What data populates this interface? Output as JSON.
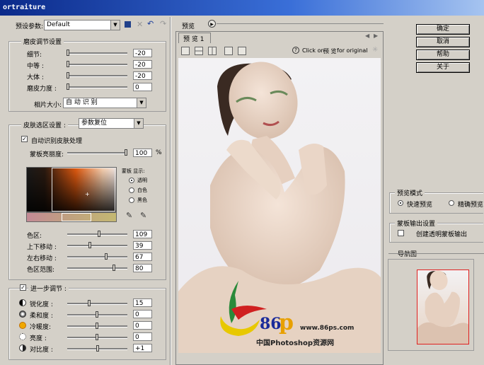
{
  "window": {
    "title": "ortraiture"
  },
  "preset": {
    "label": "预设参数:",
    "value": "Default"
  },
  "smoothing": {
    "title": "磨皮调节设置",
    "sliders": [
      {
        "label": "细节:",
        "value": "-20",
        "level": 0.0
      },
      {
        "label": "中等 :",
        "value": "-20",
        "level": 0.0
      },
      {
        "label": "大体 :",
        "value": "-20",
        "level": 0.0
      },
      {
        "label": "磨皮力度 :",
        "value": "0",
        "level": 0.0
      }
    ],
    "photo_size_label": "相片大小:",
    "photo_size_value": "自 动 识 别"
  },
  "skin": {
    "title_label": "皮肤选区设置 :",
    "title_value": "参数复位",
    "auto_detect_label": "自动识别皮肤处理",
    "mask_brightness_label": "蒙板亮丽度:",
    "mask_brightness_value": "100",
    "mask_brightness_unit": "%",
    "mask_display_label": "蒙板 显示:",
    "mask_options": [
      "透明",
      "白色",
      "黑色"
    ],
    "sliders": [
      {
        "label": "色区:",
        "value": "109",
        "level": 0.43
      },
      {
        "label": "上下移动 :",
        "value": "39",
        "level": 0.39
      },
      {
        "label": "左右移动 :",
        "value": "67",
        "level": 0.67
      },
      {
        "label": "色区范围:",
        "value": "80",
        "level": 0.8
      }
    ]
  },
  "further": {
    "title": "进一步调节 :",
    "sliders": [
      {
        "label": "锐化度 :",
        "value": "15",
        "level": 0.35,
        "icon": "sharpen-icon"
      },
      {
        "label": "柔和度 :",
        "value": "0",
        "level": 0.5,
        "icon": "softness-icon"
      },
      {
        "label": "冷暖度:",
        "value": "0",
        "level": 0.5,
        "icon": "warmth-icon"
      },
      {
        "label": "亮度 :",
        "value": "0",
        "level": 0.5,
        "icon": "brightness-icon"
      },
      {
        "label": "对比度 :",
        "value": "+1",
        "level": 0.51,
        "icon": "contrast-icon"
      }
    ]
  },
  "preview": {
    "section_label": "预览",
    "tab_label": "预 览 1",
    "hint_prefix": "Click on",
    "hint_middle": "预 览",
    "hint_suffix": "for original",
    "watermark_number": "86",
    "watermark_letter": "p",
    "watermark_url": "www.86ps.com",
    "watermark_site": "中国Photoshop资源网"
  },
  "buttons": {
    "ok": "确定",
    "cancel": "取消",
    "help": "帮助",
    "about": "关于"
  },
  "preview_mode": {
    "title": "预览模式",
    "fast": "快速预览",
    "precise": "精确预览"
  },
  "mask_output": {
    "title": "蒙板输出设置",
    "create": "创建透明蒙板输出"
  },
  "navigator": {
    "title": "导航图"
  },
  "colors": {
    "accent_orange": "#e86a1c",
    "nav_border": "#e02020",
    "title_blue": "#0b2a8a"
  }
}
